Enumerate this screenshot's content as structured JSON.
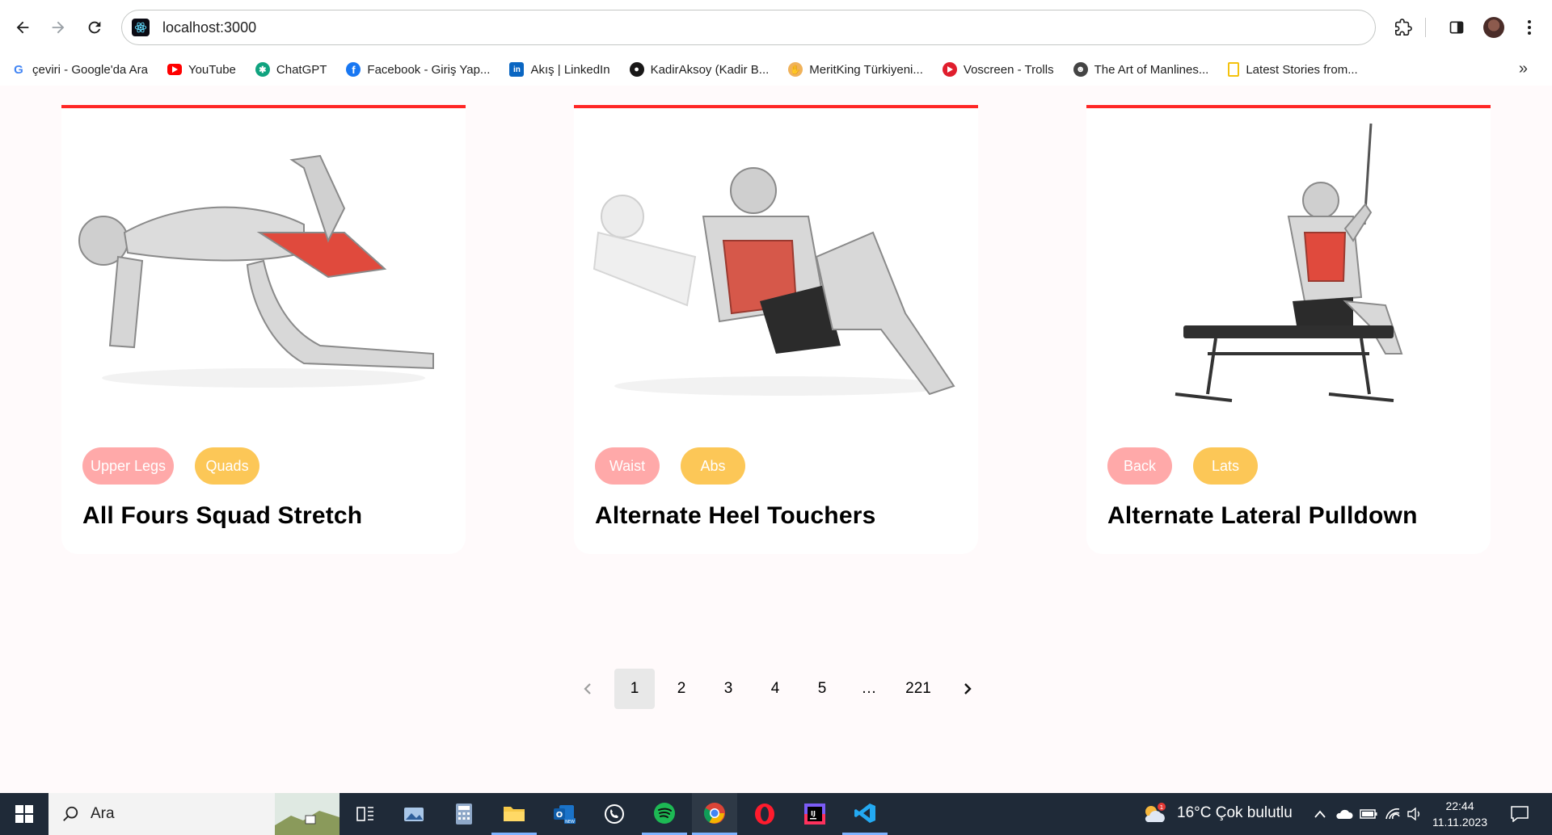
{
  "browser": {
    "url": "localhost:3000",
    "bookmarks": [
      {
        "label": "çeviri - Google'da Ara",
        "icon": "google-icon",
        "color": "#4285f4"
      },
      {
        "label": "YouTube",
        "icon": "youtube-icon",
        "color": "#ff0000"
      },
      {
        "label": "ChatGPT",
        "icon": "chatgpt-icon",
        "color": "#10a37f"
      },
      {
        "label": "Facebook - Giriş Yap...",
        "icon": "facebook-icon",
        "color": "#1877f2"
      },
      {
        "label": "Akış | LinkedIn",
        "icon": "linkedin-icon",
        "color": "#0a66c2"
      },
      {
        "label": "KadirAksoy (Kadir B...",
        "icon": "github-icon",
        "color": "#181717"
      },
      {
        "label": "MeritKing Türkiyeni...",
        "icon": "meritking-icon",
        "color": "#f0b25a"
      },
      {
        "label": "Voscreen - Trolls",
        "icon": "voscreen-icon",
        "color": "#e01e2d"
      },
      {
        "label": "The Art of Manlines...",
        "icon": "artofmanliness-icon",
        "color": "#444444"
      },
      {
        "label": "Latest Stories from...",
        "icon": "folder-bookmark-icon",
        "color": "#f4c20d"
      }
    ]
  },
  "exercises": [
    {
      "name": "All Fours Squad Stretch",
      "body_part": "Upper Legs",
      "target": "Quads",
      "illustration": "quads-stretch-illustration"
    },
    {
      "name": "Alternate Heel Touchers",
      "body_part": "Waist",
      "target": "Abs",
      "illustration": "abs-crunch-illustration"
    },
    {
      "name": "Alternate Lateral Pulldown",
      "body_part": "Back",
      "target": "Lats",
      "illustration": "lat-pulldown-illustration"
    }
  ],
  "pagination": {
    "pages": [
      "1",
      "2",
      "3",
      "4",
      "5",
      "…",
      "221"
    ],
    "current": "1"
  },
  "taskbar": {
    "search_label": "Ara",
    "weather": "16°C  Çok bulutlu",
    "weather_badge": "1",
    "time": "22:44",
    "date": "11.11.2023"
  },
  "colors": {
    "accent": "#ff2625",
    "body_part_tag": "#ffa9a9",
    "target_tag": "#fcc757",
    "page_bg": "#fffafb"
  }
}
